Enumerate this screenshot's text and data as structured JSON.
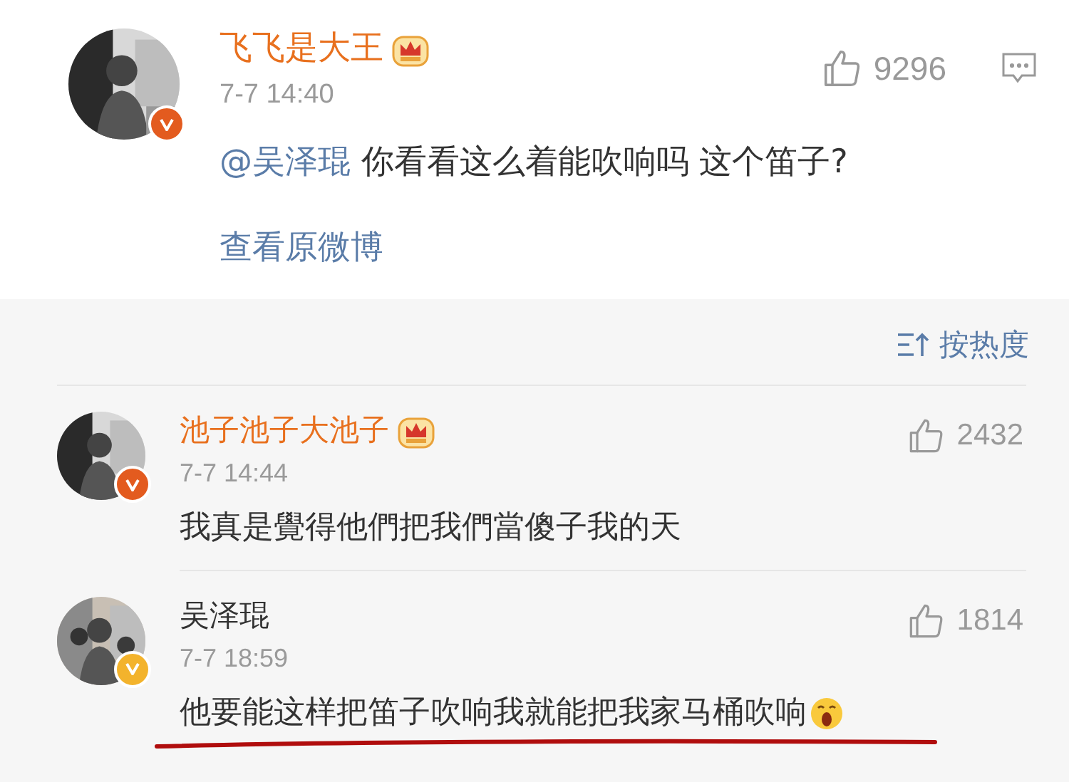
{
  "post": {
    "author": "飞飞是大王",
    "vip": true,
    "badge": {
      "color": "#e35b1f"
    },
    "time": "7-7 14:40",
    "mention": "@吴泽琨",
    "text": "你看看这么着能吹响吗 这个笛子?",
    "link": "查看原微博",
    "likes": "9296"
  },
  "sort": {
    "label": "按热度"
  },
  "comments": [
    {
      "author": "池子池子大池子",
      "vip": true,
      "badge": {
        "color": "#e35b1f"
      },
      "time": "7-7 14:44",
      "text": "我真是覺得他們把我們當傻子我的天",
      "likes": "2432",
      "emoji": false,
      "underlined": false
    },
    {
      "author": "吴泽琨",
      "vip": false,
      "badge": {
        "color": "#f3b32c"
      },
      "time": "7-7 18:59",
      "text": "他要能这样把笛子吹响我就能把我家马桶吹响",
      "likes": "1814",
      "emoji": true,
      "underlined": true
    }
  ]
}
